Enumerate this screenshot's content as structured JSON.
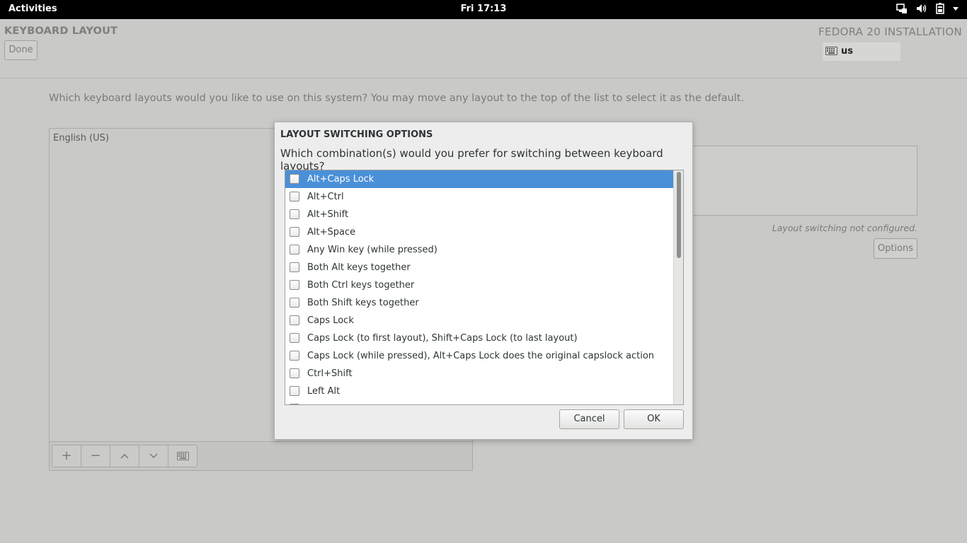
{
  "topbar": {
    "activities": "Activities",
    "clock": "Fri 17:13",
    "tray_icons": [
      "network-icon",
      "volume-icon",
      "battery-icon",
      "chevron-down-icon"
    ]
  },
  "header": {
    "spoke_title": "KEYBOARD LAYOUT",
    "done_label": "Done",
    "product_title": "FEDORA 20 INSTALLATION",
    "keyboard_indicator": "us"
  },
  "main": {
    "question": "Which keyboard layouts would you like to use on this system?  You may move any layout to the top of the list to select it as the default.",
    "layouts": [
      "English (US)"
    ],
    "toolbar": {
      "add": "+",
      "remove": "−"
    },
    "switching_status": "Layout switching not configured.",
    "options_label": "Options"
  },
  "dialog": {
    "title": "LAYOUT SWITCHING OPTIONS",
    "question": "Which combination(s) would you prefer for switching between keyboard layouts?",
    "options": [
      {
        "label": "Alt+Caps Lock",
        "selected": true,
        "checked": false
      },
      {
        "label": "Alt+Ctrl",
        "selected": false,
        "checked": false
      },
      {
        "label": "Alt+Shift",
        "selected": false,
        "checked": false
      },
      {
        "label": "Alt+Space",
        "selected": false,
        "checked": false
      },
      {
        "label": "Any Win key (while pressed)",
        "selected": false,
        "checked": false
      },
      {
        "label": "Both Alt keys together",
        "selected": false,
        "checked": false
      },
      {
        "label": "Both Ctrl keys together",
        "selected": false,
        "checked": false
      },
      {
        "label": "Both Shift keys together",
        "selected": false,
        "checked": false
      },
      {
        "label": "Caps Lock",
        "selected": false,
        "checked": false
      },
      {
        "label": "Caps Lock (to first layout), Shift+Caps Lock (to last layout)",
        "selected": false,
        "checked": false
      },
      {
        "label": "Caps Lock (while pressed), Alt+Caps Lock does the original capslock action",
        "selected": false,
        "checked": false
      },
      {
        "label": "Ctrl+Shift",
        "selected": false,
        "checked": false
      },
      {
        "label": "Left Alt",
        "selected": false,
        "checked": false
      },
      {
        "label": "",
        "selected": false,
        "checked": false
      }
    ],
    "cancel_label": "Cancel",
    "ok_label": "OK"
  },
  "colors": {
    "selection": "#4a90d9",
    "topbar": "#000000",
    "dimmed_background": "#c9c9c7",
    "dialog_background": "#ededed"
  }
}
